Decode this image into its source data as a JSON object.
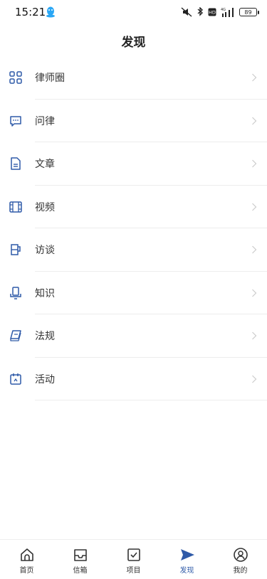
{
  "status_bar": {
    "time": "15:21",
    "network": "4G",
    "hd_label": "HD",
    "battery": "89"
  },
  "header": {
    "title": "发现"
  },
  "menu": {
    "items": [
      {
        "label": "律师圈",
        "icon": "grid-icon"
      },
      {
        "label": "问律",
        "icon": "chat-bubble-icon"
      },
      {
        "label": "文章",
        "icon": "document-icon"
      },
      {
        "label": "视频",
        "icon": "film-icon"
      },
      {
        "label": "访谈",
        "icon": "interview-icon"
      },
      {
        "label": "知识",
        "icon": "knowledge-icon"
      },
      {
        "label": "法规",
        "icon": "law-book-icon"
      },
      {
        "label": "活动",
        "icon": "activity-icon"
      }
    ]
  },
  "tab_bar": {
    "items": [
      {
        "label": "首页",
        "icon": "home-icon"
      },
      {
        "label": "信箱",
        "icon": "inbox-icon"
      },
      {
        "label": "项目",
        "icon": "checkbox-icon"
      },
      {
        "label": "发现",
        "icon": "send-icon",
        "active": true
      },
      {
        "label": "我的",
        "icon": "profile-icon"
      }
    ]
  },
  "colors": {
    "accent": "#2f5aa8",
    "text": "#333333",
    "divider": "#ededed"
  }
}
